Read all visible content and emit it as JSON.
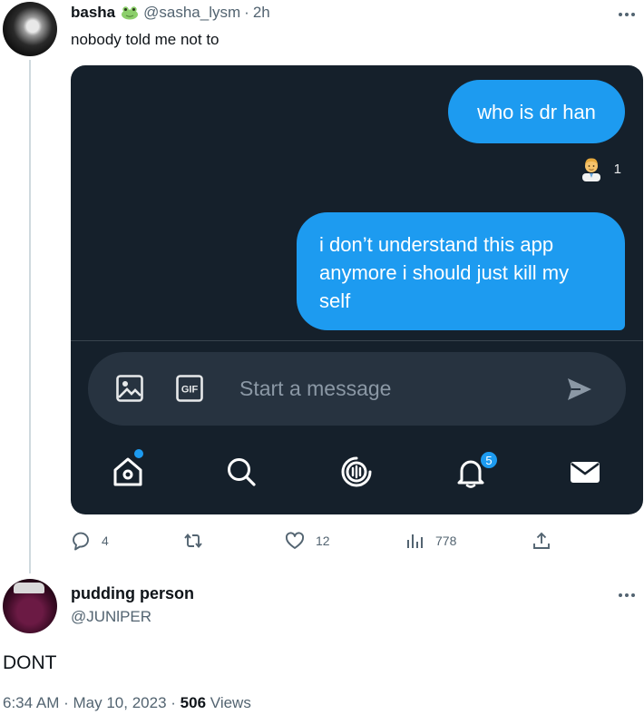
{
  "original_tweet": {
    "author_name": "basha",
    "author_badge_icon": "frog-emoji",
    "handle": "@sasha_lysm",
    "separator": "·",
    "time": "2h",
    "text": "nobody told me not to",
    "more_icon": "more-horizontal-icon",
    "media": {
      "messages": [
        {
          "text": "who is dr han"
        },
        {
          "text": "i don’t understand this app anymore i should just kill my self"
        }
      ],
      "reaction": {
        "icon": "health-worker-emoji",
        "count": "1"
      },
      "composer": {
        "placeholder": "Start a message",
        "image_icon": "image-icon",
        "gif_icon": "gif-icon",
        "send_icon": "send-icon"
      },
      "bottom_nav": [
        {
          "icon": "home-icon"
        },
        {
          "icon": "search-icon"
        },
        {
          "icon": "spaces-icon"
        },
        {
          "icon": "bell-icon",
          "badge": "5"
        },
        {
          "icon": "mail-icon"
        }
      ]
    },
    "actions": {
      "reply_count": "4",
      "retweet_count": "",
      "like_count": "12",
      "views_count": "778"
    }
  },
  "reply_tweet": {
    "author_name": "pudding person",
    "handle": "@JUNlPER",
    "text": "DONT",
    "time": "6:34 AM",
    "date": "May 10, 2023",
    "separator": "·",
    "views_count": "506",
    "views_label": "Views"
  },
  "colors": {
    "accent": "#1d9bf0",
    "dark_bg": "#15202b",
    "composer_bg": "#273340",
    "secondary_text": "#536471"
  }
}
